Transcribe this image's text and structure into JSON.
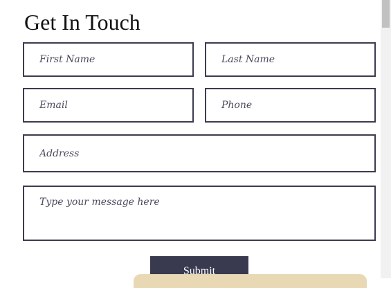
{
  "form": {
    "title": "Get In Touch",
    "first_name_placeholder": "First Name",
    "last_name_placeholder": "Last Name",
    "email_placeholder": "Email",
    "phone_placeholder": "Phone",
    "address_placeholder": "Address",
    "message_placeholder": "Type your message here",
    "submit_label": "Submit"
  },
  "colors": {
    "border": "#3b3b50",
    "button": "#393950",
    "cookie_bar": "#e8d9b4"
  }
}
